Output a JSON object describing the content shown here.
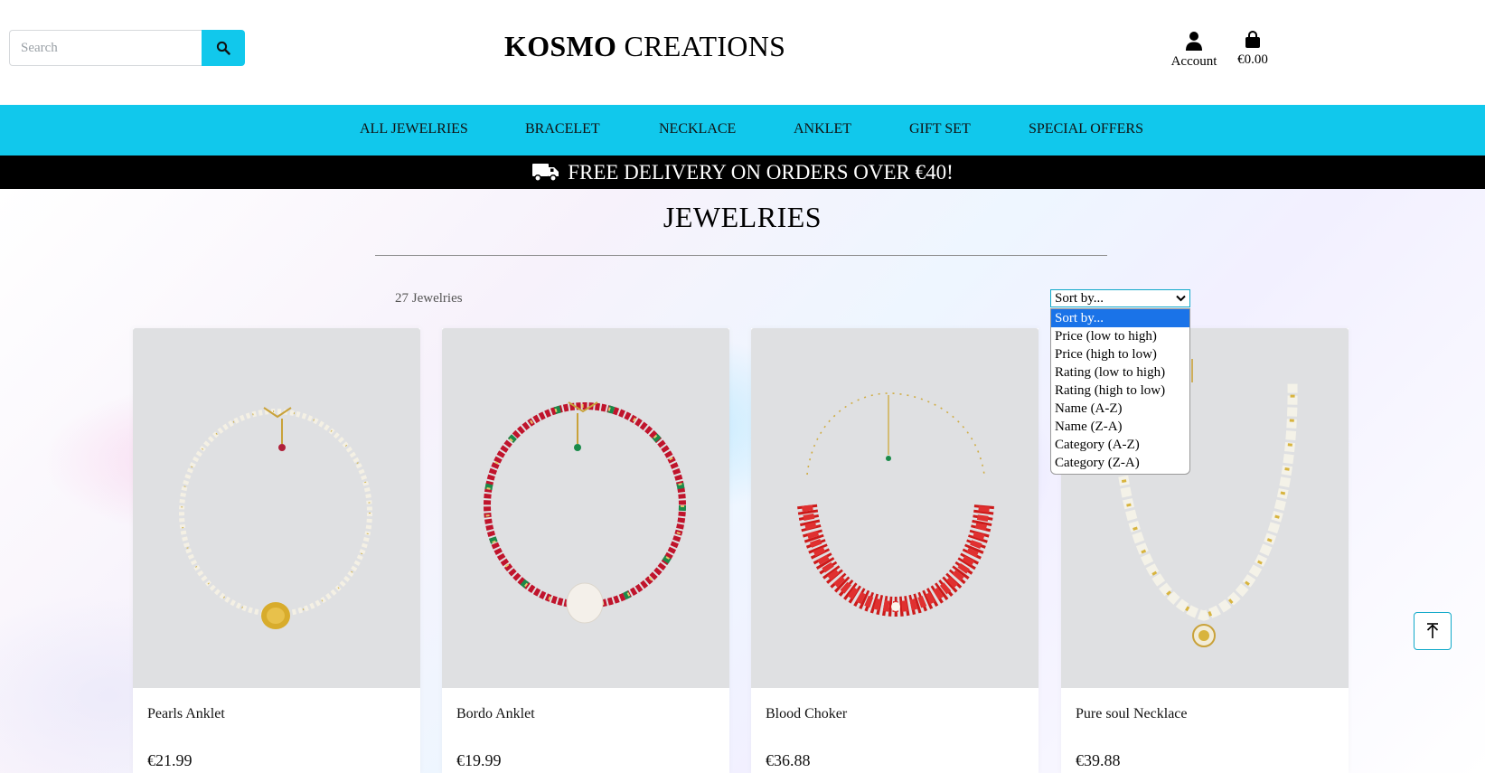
{
  "search": {
    "placeholder": "Search",
    "icon": "search-icon"
  },
  "brand": {
    "bold": "KOSMO",
    "light": "CREATIONS"
  },
  "account": {
    "label": "Account",
    "icon": "user-icon"
  },
  "bag": {
    "total": "€0.00",
    "icon": "shopping-bag-icon"
  },
  "nav": {
    "items": [
      "ALL JEWELRIES",
      "BRACELET",
      "NECKLACE",
      "ANKLET",
      "GIFT SET",
      "SPECIAL OFFERS"
    ]
  },
  "banner": {
    "text": "FREE DELIVERY ON ORDERS OVER €40!",
    "icon": "truck-icon"
  },
  "page": {
    "title": "JEWELRIES",
    "count": "27 Jewelries"
  },
  "sort": {
    "selected": "Sort by...",
    "options": [
      "Sort by...",
      "Price (low to high)",
      "Price (high to low)",
      "Rating (low to high)",
      "Rating (high to low)",
      "Name (A-Z)",
      "Name (Z-A)",
      "Category (A-Z)",
      "Category (Z-A)"
    ]
  },
  "products": [
    {
      "name": "Pearls Anklet",
      "price": "€21.99"
    },
    {
      "name": "Bordo Anklet",
      "price": "€19.99"
    },
    {
      "name": "Blood Choker",
      "price": "€36.88"
    },
    {
      "name": "Pure soul Necklace",
      "price": "€39.88"
    }
  ],
  "colors": {
    "accent": "#11c8ec",
    "banner": "#000000",
    "select_highlight": "#1a73e8"
  },
  "scroll_top": {
    "icon": "arrow-up-icon"
  }
}
